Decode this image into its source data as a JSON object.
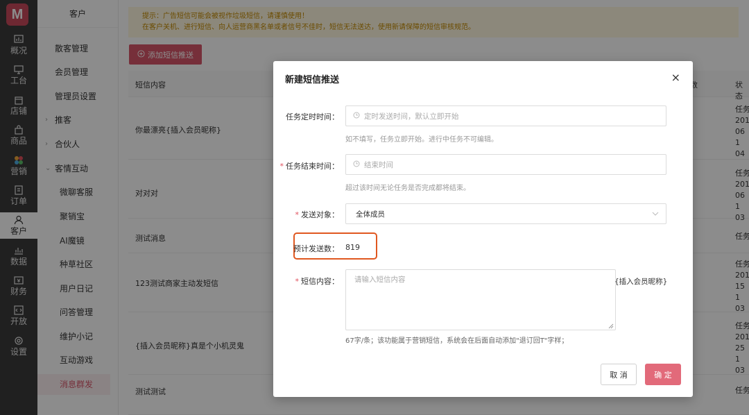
{
  "rail": {
    "items": [
      {
        "label": "概况",
        "icon": "overview-icon"
      },
      {
        "label": "工台",
        "icon": "desktop-icon"
      },
      {
        "label": "店铺",
        "icon": "store-icon"
      },
      {
        "label": "商品",
        "icon": "bag-icon"
      },
      {
        "label": "营销",
        "icon": "marketing-icon"
      },
      {
        "label": "订单",
        "icon": "order-icon"
      },
      {
        "label": "客户",
        "icon": "user-icon"
      },
      {
        "label": "数据",
        "icon": "data-icon"
      },
      {
        "label": "财务",
        "icon": "finance-icon"
      },
      {
        "label": "开放",
        "icon": "code-icon"
      },
      {
        "label": "设置",
        "icon": "gear-icon"
      }
    ]
  },
  "sidebar": {
    "title": "客户",
    "items": [
      {
        "label": "散客管理"
      },
      {
        "label": "会员管理"
      },
      {
        "label": "管理员设置"
      },
      {
        "label": "推客"
      },
      {
        "label": "合伙人"
      },
      {
        "label": "客情互动"
      },
      {
        "label": "微聊客服"
      },
      {
        "label": "聚销宝"
      },
      {
        "label": "AI魔镜"
      },
      {
        "label": "种草社区"
      },
      {
        "label": "用户日记"
      },
      {
        "label": "问答管理"
      },
      {
        "label": "维护小记"
      },
      {
        "label": "互动游戏"
      },
      {
        "label": "消息群发"
      }
    ]
  },
  "main": {
    "notice_line1": "提示：广告短信可能会被视作垃圾短信，请谨慎使用！",
    "notice_line2": "在客户关机、进行短信、向人运营商黑名单或者信号不佳时，短信无法送达，使用新请保障的短信审核规范。",
    "add_button": "添加短信推送",
    "col_content": "短信内容",
    "col_count": "数",
    "col_status": "状态",
    "rows": [
      {
        "content": "你最漂亮{插入会员昵称}",
        "status": "任务 201 06 1 04"
      },
      {
        "content": "对对对",
        "status": "任务 201 06 1 03"
      },
      {
        "content": "测试消息",
        "status": "任务"
      },
      {
        "content": "123测试商家主动发短信",
        "status": "任务 201 15 1 03"
      },
      {
        "content": "{插入会员昵称}真是个小机灵鬼",
        "status": "任务 201 25 1 03"
      },
      {
        "content": "测试测试",
        "status": "任务"
      }
    ]
  },
  "modal": {
    "title": "新建短信推送",
    "close": "×",
    "start_label": "任务定时时间：",
    "start_placeholder": "定时发送时间，默认立即开始",
    "start_hint": "如不填写，任务立即开始。进行中任务不可编辑。",
    "end_required": "*",
    "end_label": "任务结束时间：",
    "end_placeholder": "结束时间",
    "end_hint": "超过该时间无论任务是否完成都将结束。",
    "target_required": "*",
    "target_label": "发送对象：",
    "target_value": "全体成员",
    "estimate_label": "预计发送数：",
    "estimate_value": "819",
    "content_required": "*",
    "content_label": "短信内容：",
    "content_placeholder": "请输入短信内容",
    "content_tag": "{插入会员昵称}",
    "content_hint": "67字/条；该功能属于营销短信，系统会在后面自动添加\"退订回T\"字样；",
    "cancel": "取 消",
    "ok": "确 定"
  }
}
